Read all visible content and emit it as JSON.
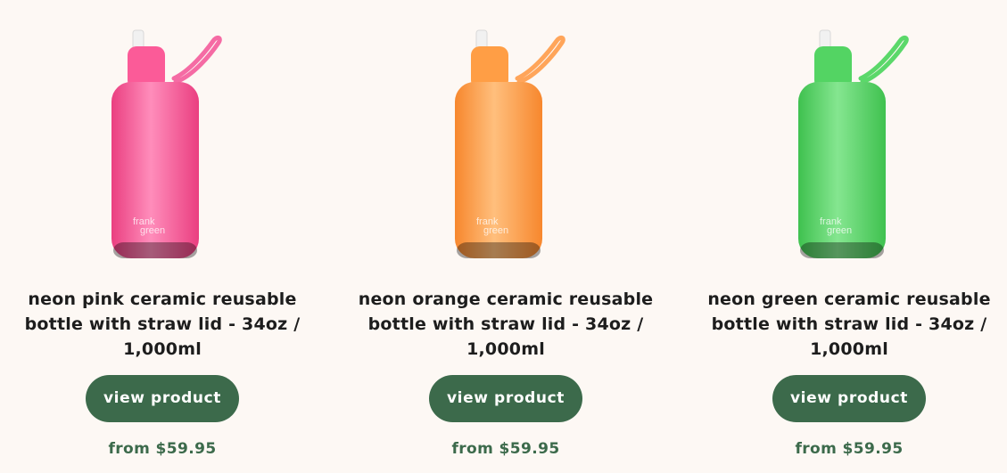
{
  "products": [
    {
      "title_line1": "neon pink ceramic reusable",
      "title_line2": "bottle with straw lid - 34oz /",
      "title_line3": "1,000ml",
      "button_label": "view product",
      "price": "from $59.95",
      "brand_mark_line1": "frank",
      "brand_mark_line2": "green",
      "bottle_color": "#fb5b98",
      "bottle_color_light": "#ff8dbb",
      "bottle_color_dark": "#ea3f80",
      "strap_color": "#f56ba4"
    },
    {
      "title_line1": "neon orange ceramic reusable",
      "title_line2": "bottle with straw lid - 34oz /",
      "title_line3": "1,000ml",
      "button_label": "view product",
      "price": "from $59.95",
      "brand_mark_line1": "frank",
      "brand_mark_line2": "green",
      "bottle_color": "#ff9e45",
      "bottle_color_light": "#ffbf7d",
      "bottle_color_dark": "#f7872d",
      "strap_color": "#ffa55a"
    },
    {
      "title_line1": "neon green ceramic reusable",
      "title_line2": "bottle with straw lid - 34oz /",
      "title_line3": "1,000ml",
      "button_label": "view product",
      "price": "from $59.95",
      "brand_mark_line1": "frank",
      "brand_mark_line2": "green",
      "bottle_color": "#53d463",
      "bottle_color_light": "#85e690",
      "bottle_color_dark": "#3fc14f",
      "strap_color": "#5bd86a"
    }
  ],
  "colors": {
    "background": "#fdf8f4",
    "button": "#3c6a4b",
    "price_text": "#3c6a4b",
    "title_text": "#1d1d1d"
  }
}
